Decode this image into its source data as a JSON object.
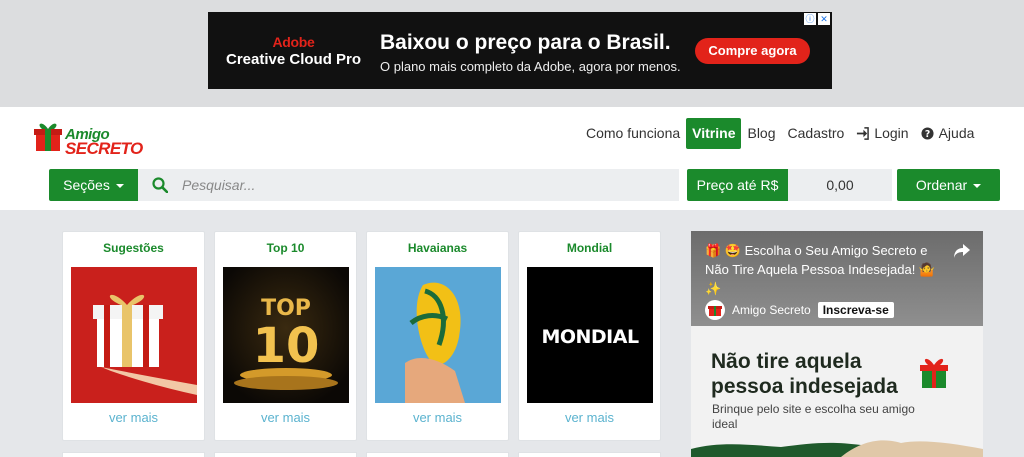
{
  "ad": {
    "brand_line1": "Adobe",
    "brand_line2": "Creative Cloud Pro",
    "headline": "Baixou o preço para o Brasil.",
    "subline": "O plano mais completo da Adobe, agora por menos.",
    "cta": "Compre agora",
    "colors": {
      "background": "#111111",
      "accent": "#e2231a"
    }
  },
  "logo": {
    "line1": "Amigo",
    "line2": "SECRETO"
  },
  "nav": [
    {
      "label": "Como funciona",
      "icon": null,
      "active": false
    },
    {
      "label": "Vitrine",
      "icon": null,
      "active": true
    },
    {
      "label": "Blog",
      "icon": null,
      "active": false
    },
    {
      "label": "Cadastro",
      "icon": null,
      "active": false
    },
    {
      "label": "Login",
      "icon": "sign-in-icon",
      "active": false
    },
    {
      "label": "Ajuda",
      "icon": "question-circle-icon",
      "active": false
    }
  ],
  "toolbar": {
    "secoes": "Seções",
    "search_placeholder": "Pesquisar...",
    "preco_label": "Preço até R$",
    "preco_value": "0,00",
    "ordenar": "Ordenar"
  },
  "cards": [
    {
      "title": "Sugestões",
      "image": "gift-box",
      "more": "ver mais"
    },
    {
      "title": "Top 10",
      "image": "top-10-trophy",
      "more": "ver mais"
    },
    {
      "title": "Havaianas",
      "image": "flip-flop",
      "more": "ver mais"
    },
    {
      "title": "Mondial",
      "image": "mondial-logo",
      "image_text": "MONDIAL",
      "more": "ver mais"
    }
  ],
  "top10_badge": {
    "top": "TOP",
    "number": "10"
  },
  "video": {
    "title": "🎁 🤩 Escolha o Seu Amigo Secreto e Não Tire Aquela Pessoa Indesejada! 🤷 ✨",
    "channel": "Amigo Secreto",
    "subscribe": "Inscreva-se",
    "headline_line1": "Não tire aquela",
    "headline_line2": "pessoa indesejada",
    "subtext": "Brinque pelo site e escolha seu amigo ideal"
  },
  "colors": {
    "brand_green": "#1b8a2c",
    "brand_red": "#e2231a",
    "link_blue": "#5bb3cf"
  }
}
